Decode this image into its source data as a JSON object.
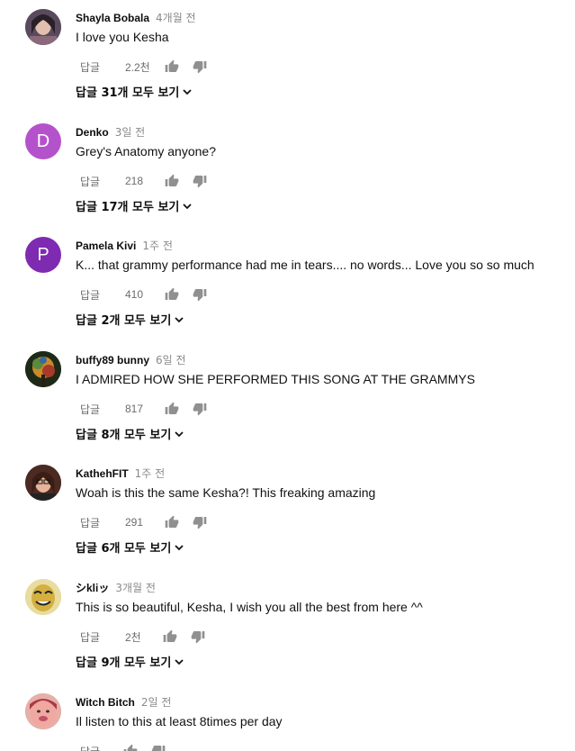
{
  "comments": [
    {
      "author": "Shayla Bobala",
      "time": "4개월 전",
      "text": "I love you Kesha",
      "reply_label": "답글",
      "likes": "2.2천",
      "view_replies": "답글 31개 모두 보기",
      "avatar": {
        "type": "photo",
        "color": "#6b5566"
      }
    },
    {
      "author": "Denko",
      "time": "3일 전",
      "text": "Grey's Anatomy anyone?",
      "reply_label": "답글",
      "likes": "218",
      "view_replies": "답글 17개 모두 보기",
      "avatar": {
        "type": "letter",
        "letter": "D",
        "color": "#b452cc"
      }
    },
    {
      "author": "Pamela Kivi",
      "time": "1주 전",
      "text": "K... that grammy performance had me in tears.... no words... Love you so so much",
      "reply_label": "답글",
      "likes": "410",
      "view_replies": "답글 2개 모두 보기",
      "avatar": {
        "type": "letter",
        "letter": "P",
        "color": "#7e2ab1"
      }
    },
    {
      "author": "buffy89 bunny",
      "time": "6일 전",
      "text": "I ADMIRED HOW SHE PERFORMED THIS SONG AT THE GRAMMYS",
      "reply_label": "답글",
      "likes": "817",
      "view_replies": "답글 8개 모두 보기",
      "avatar": {
        "type": "photo",
        "color": "#3a4a2e"
      }
    },
    {
      "author": "KathehFIT",
      "time": "1주 전",
      "text": "Woah is this the same Kesha?! This freaking amazing",
      "reply_label": "답글",
      "likes": "291",
      "view_replies": "답글 6개 모두 보기",
      "avatar": {
        "type": "photo",
        "color": "#7a4a3a"
      }
    },
    {
      "author": "シkliッ",
      "time": "3개월 전",
      "text": "This is so beautiful, Kesha, I wish you all the best from here ^^",
      "reply_label": "답글",
      "likes": "2천",
      "view_replies": "답글 9개 모두 보기",
      "avatar": {
        "type": "photo",
        "color": "#d8c36a"
      }
    },
    {
      "author": "Witch Bitch",
      "time": "2일 전",
      "text": "Il listen to this at least 8times per day",
      "reply_label": "답글",
      "likes": "",
      "view_replies": "",
      "avatar": {
        "type": "photo",
        "color": "#d98a8a"
      }
    }
  ],
  "icons": {
    "like": "thumbs-up-icon",
    "dislike": "thumbs-down-icon",
    "expand": "chevron-down-icon"
  },
  "colors": {
    "icon": "#909090",
    "secondary_text": "#6b6b6b",
    "timestamp": "#8a8a8a"
  }
}
